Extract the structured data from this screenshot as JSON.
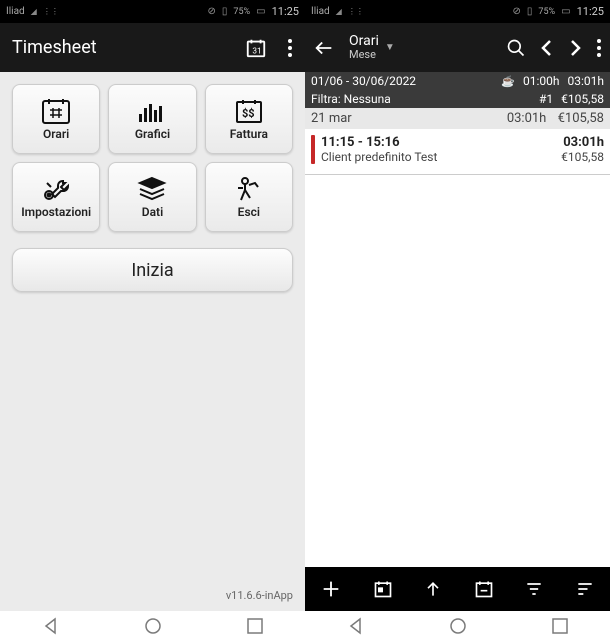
{
  "status": {
    "carrier": "Iliad",
    "battery_pct": "75%",
    "time": "11:25"
  },
  "left": {
    "title": "Timesheet",
    "tiles": {
      "orari": "Orari",
      "grafici": "Grafici",
      "fattura": "Fattura",
      "impostazioni": "Impostazioni",
      "dati": "Dati",
      "esci": "Esci"
    },
    "start": "Inizia",
    "version": "v11.6.6-inApp"
  },
  "right": {
    "header": {
      "title": "Orari",
      "subtitle": "Mese"
    },
    "range": {
      "date": "01/06 - 30/06/2022",
      "h1": "01:00h",
      "h2": "03:01h",
      "filter_label": "Filtra:",
      "filter_value": "Nessuna",
      "count": "#1",
      "amount": "€105,58"
    },
    "day": {
      "date": "21 mar",
      "hours": "03:01h",
      "amount": "€105,58"
    },
    "entry": {
      "time": "11:15 - 15:16",
      "hours": "03:01h",
      "client": "Client predefinito Test",
      "amount": "€105,58"
    }
  }
}
